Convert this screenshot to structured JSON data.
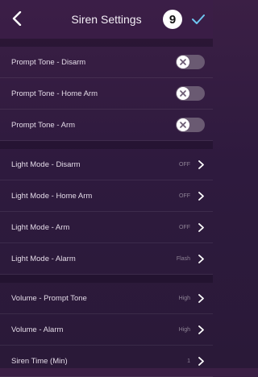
{
  "header": {
    "title": "Siren Settings",
    "badge": "9"
  },
  "prompt_tones": [
    {
      "label": "Prompt Tone - Disarm",
      "state": "off"
    },
    {
      "label": "Prompt Tone - Home Arm",
      "state": "off"
    },
    {
      "label": "Prompt Tone - Arm",
      "state": "off"
    }
  ],
  "light_modes": [
    {
      "label": "Light Mode - Disarm",
      "value": "OFF"
    },
    {
      "label": "Light Mode - Home Arm",
      "value": "OFF"
    },
    {
      "label": "Light Mode - Arm",
      "value": "OFF"
    },
    {
      "label": "Light Mode - Alarm",
      "value": "Flash"
    }
  ],
  "other": [
    {
      "label": "Volume - Prompt Tone",
      "value": "High"
    },
    {
      "label": "Volume - Alarm",
      "value": "High"
    },
    {
      "label": "Siren Time (Min)",
      "value": "1"
    }
  ],
  "colors": {
    "background": "#2e1a3e",
    "toggle_track": "#6a5a72",
    "check_accent": "#6ec6f0"
  }
}
